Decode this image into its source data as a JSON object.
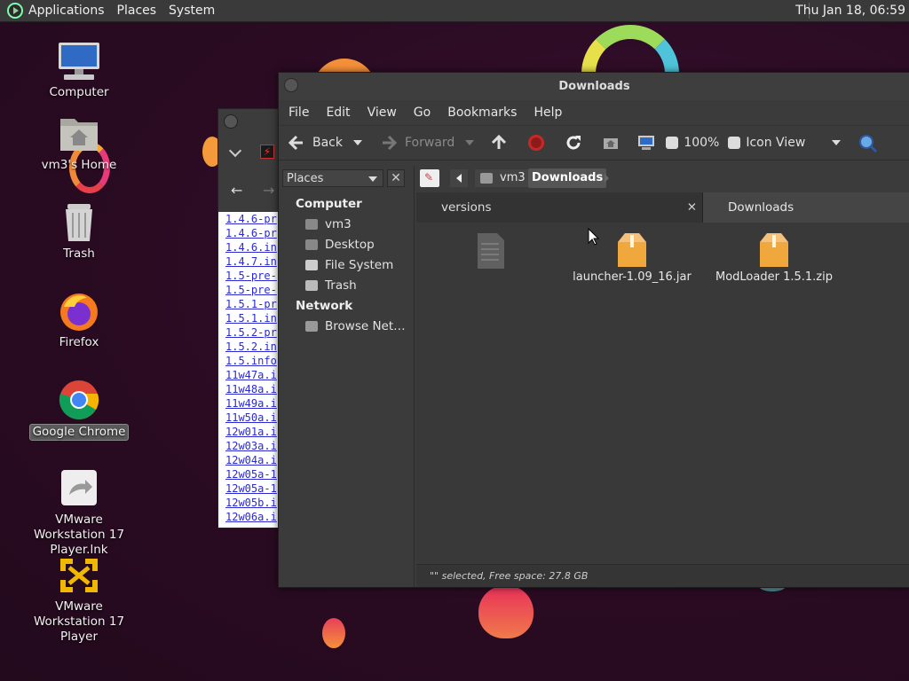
{
  "panel": {
    "menus": [
      "Applications",
      "Places",
      "System"
    ],
    "clock": "Thu Jan 18, 06:59"
  },
  "desktop": {
    "icons": [
      {
        "label": "Computer",
        "icon": "computer-icon"
      },
      {
        "label": "vm3's Home",
        "icon": "home-folder-icon"
      },
      {
        "label": "Trash",
        "icon": "trash-icon"
      },
      {
        "label": "Firefox",
        "icon": "firefox-icon"
      },
      {
        "label": "Google Chrome",
        "icon": "chrome-icon"
      },
      {
        "label": "VMware Workstation 17 Player.lnk",
        "icon": "shortcut-icon"
      },
      {
        "label": "VMware Workstation 17 Player",
        "icon": "vmware-icon"
      }
    ]
  },
  "browser": {
    "links": [
      "1.4.6-pr",
      "1.4.6-pr",
      "1.4.6.in",
      "1.4.7.in",
      "1.5-pre-",
      "1.5-pre-",
      "1.5.1-pr",
      "1.5.1.in",
      "1.5.2-pr",
      "1.5.2.in",
      "1.5.info",
      "11w47a.i",
      "11w48a.i",
      "11w49a.i",
      "11w50a.i",
      "12w01a.i",
      "12w03a.i",
      "12w04a.i",
      "12w05a-1",
      "12w05a-1",
      "12w05b.i",
      "12w06a.i"
    ]
  },
  "filemanager": {
    "title": "Downloads",
    "menus": [
      "File",
      "Edit",
      "View",
      "Go",
      "Bookmarks",
      "Help"
    ],
    "toolbar": {
      "back": "Back",
      "forward": "Forward",
      "zoom": "100%",
      "view_mode": "Icon View"
    },
    "sidebar": {
      "selector": "Places",
      "computer_header": "Computer",
      "computer_items": [
        "vm3",
        "Desktop",
        "File System",
        "Trash"
      ],
      "network_header": "Network",
      "network_items": [
        "Browse Net…"
      ]
    },
    "path": {
      "parent": "vm3",
      "current": "Downloads"
    },
    "tabs": [
      {
        "label": "versions",
        "active": false
      },
      {
        "label": "Downloads",
        "active": true
      }
    ],
    "files": [
      {
        "name": "",
        "type": "document"
      },
      {
        "name": "launcher-1.09_16.jar",
        "type": "archive"
      },
      {
        "name": "ModLoader 1.5.1.zip",
        "type": "archive"
      }
    ],
    "status": "\"\" selected, Free space: 27.8 GB"
  },
  "colors": {
    "accent_archive": "#f0a73c",
    "wallpaper": "#2a0b22"
  }
}
